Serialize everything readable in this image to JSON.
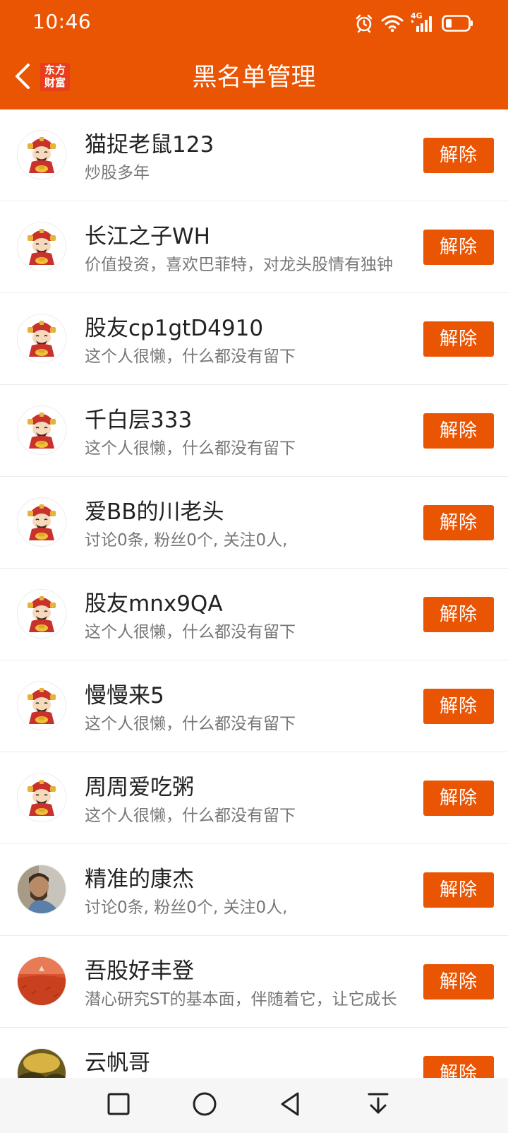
{
  "status_bar": {
    "time": "10:46",
    "icons": [
      "alarm-icon",
      "wifi-icon",
      "signal-4g-icon",
      "battery-icon"
    ],
    "network": "4G"
  },
  "header": {
    "title": "黑名单管理",
    "logo_line1": "东方",
    "logo_line2": "财富",
    "back_icon": "chevron-left-icon"
  },
  "colors": {
    "accent": "#ea5504",
    "logo_red": "#e83e1a",
    "name_text": "#222222",
    "desc_text": "#777777",
    "divider": "#ececec"
  },
  "action_label": "解除",
  "blacklist": [
    {
      "name": "猫捉老鼠123",
      "desc": "炒股多年",
      "avatar": "fortune-god-avatar"
    },
    {
      "name": "长江之子WH",
      "desc": "价值投资，喜欢巴菲特，对龙头股情有独钟",
      "avatar": "fortune-god-avatar"
    },
    {
      "name": "股友cp1gtD4910",
      "desc": "这个人很懒，什么都没有留下",
      "avatar": "fortune-god-avatar"
    },
    {
      "name": "千白层333",
      "desc": "这个人很懒，什么都没有留下",
      "avatar": "fortune-god-avatar"
    },
    {
      "name": "爱BB的川老头",
      "desc": "讨论0条, 粉丝0个, 关注0人,",
      "avatar": "fortune-god-avatar"
    },
    {
      "name": "股友mnx9QA",
      "desc": "这个人很懒，什么都没有留下",
      "avatar": "fortune-god-avatar"
    },
    {
      "name": "慢慢来5",
      "desc": "这个人很懒，什么都没有留下",
      "avatar": "fortune-god-avatar"
    },
    {
      "name": "周周爱吃粥",
      "desc": "这个人很懒，什么都没有留下",
      "avatar": "fortune-god-avatar"
    },
    {
      "name": "精准的康杰",
      "desc": "讨论0条, 粉丝0个, 关注0人,",
      "avatar": "photo-avatar-man"
    },
    {
      "name": "吾股好丰登",
      "desc": "潜心研究ST的基本面，伴随着它，让它成长",
      "avatar": "photo-avatar-field"
    },
    {
      "name": "云帆哥",
      "desc": "",
      "avatar": "photo-avatar-landscape"
    }
  ],
  "nav_bar": {
    "buttons": [
      "recent-apps-icon",
      "home-icon",
      "back-icon",
      "notification-pull-icon"
    ]
  }
}
